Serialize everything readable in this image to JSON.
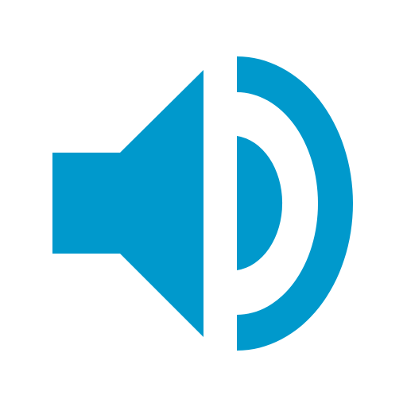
{
  "icon": {
    "name": "speaker-volume-icon",
    "color": "#0099CC",
    "background": "#FFFFFF"
  }
}
